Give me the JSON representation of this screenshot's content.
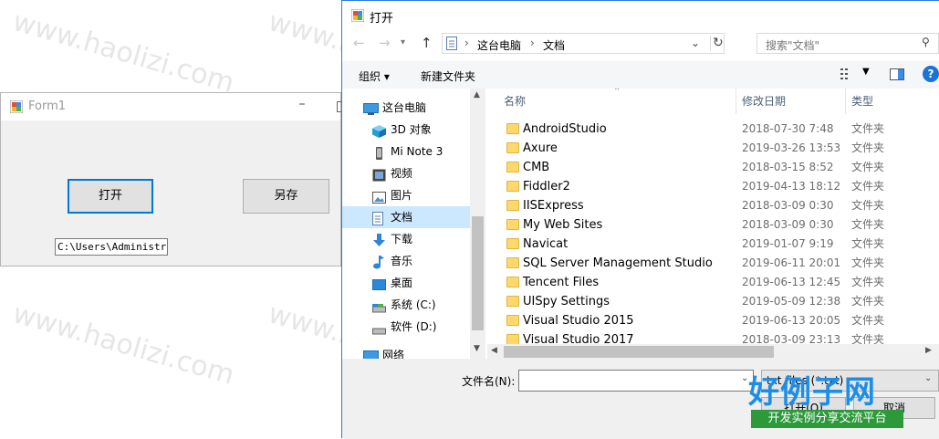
{
  "watermark_text": "www.haolizi.com",
  "form1": {
    "title": "Form1",
    "minimize_glyph": "–",
    "open_button": "打开",
    "saveas_button": "另存",
    "path_value": "C:\\Users\\Administrat"
  },
  "dialog": {
    "title": "打开",
    "breadcrumb": [
      "这台电脑",
      "文档"
    ],
    "search_placeholder": "搜索\"文档\"",
    "organize": "组织 ▾",
    "new_folder": "新建文件夹",
    "nav_items": [
      {
        "label": "这台电脑",
        "icon": "computer-icon"
      },
      {
        "label": "3D 对象",
        "icon": "cube-icon"
      },
      {
        "label": "Mi Note 3",
        "icon": "phone-icon"
      },
      {
        "label": "视频",
        "icon": "video-icon"
      },
      {
        "label": "图片",
        "icon": "picture-icon"
      },
      {
        "label": "文档",
        "icon": "document-icon"
      },
      {
        "label": "下载",
        "icon": "download-icon"
      },
      {
        "label": "音乐",
        "icon": "music-icon"
      },
      {
        "label": "桌面",
        "icon": "desktop-icon"
      },
      {
        "label": "系统 (C:)",
        "icon": "drive-icon"
      },
      {
        "label": "软件 (D:)",
        "icon": "drive-icon"
      },
      {
        "label": "网络",
        "icon": "network-icon"
      }
    ],
    "columns": {
      "name": "名称",
      "date": "修改日期",
      "type": "类型"
    },
    "files": [
      {
        "name": "AndroidStudio",
        "date": "2018-07-30 7:48",
        "type": "文件夹"
      },
      {
        "name": "Axure",
        "date": "2019-03-26 13:53",
        "type": "文件夹"
      },
      {
        "name": "CMB",
        "date": "2018-03-15 8:52",
        "type": "文件夹"
      },
      {
        "name": "Fiddler2",
        "date": "2019-04-13 18:12",
        "type": "文件夹"
      },
      {
        "name": "IISExpress",
        "date": "2018-03-09 0:30",
        "type": "文件夹"
      },
      {
        "name": "My Web Sites",
        "date": "2018-03-09 0:30",
        "type": "文件夹"
      },
      {
        "name": "Navicat",
        "date": "2019-01-07 9:19",
        "type": "文件夹"
      },
      {
        "name": "SQL Server Management Studio",
        "date": "2019-06-11 20:01",
        "type": "文件夹"
      },
      {
        "name": "Tencent Files",
        "date": "2019-06-13 12:45",
        "type": "文件夹"
      },
      {
        "name": "UISpy Settings",
        "date": "2019-05-09 12:38",
        "type": "文件夹"
      },
      {
        "name": "Visual Studio 2015",
        "date": "2019-06-13 20:05",
        "type": "文件夹"
      },
      {
        "name": "Visual Studio 2017",
        "date": "2018-03-09 23:13",
        "type": "文件夹"
      }
    ],
    "filename_label": "文件名(N):",
    "filename_value": "",
    "filter_value": "txt files (*.txt)",
    "open_button": "打开(O)",
    "cancel_button": "取消"
  },
  "logo": {
    "main": "好例子网",
    "sub": "开发实例分享交流平台"
  },
  "colors": {
    "accent": "#0078d7",
    "folder": "#ffd86b",
    "selection": "#cce8ff",
    "logo_blue": "#1d8ee8",
    "logo_green": "#2c9a3a"
  }
}
